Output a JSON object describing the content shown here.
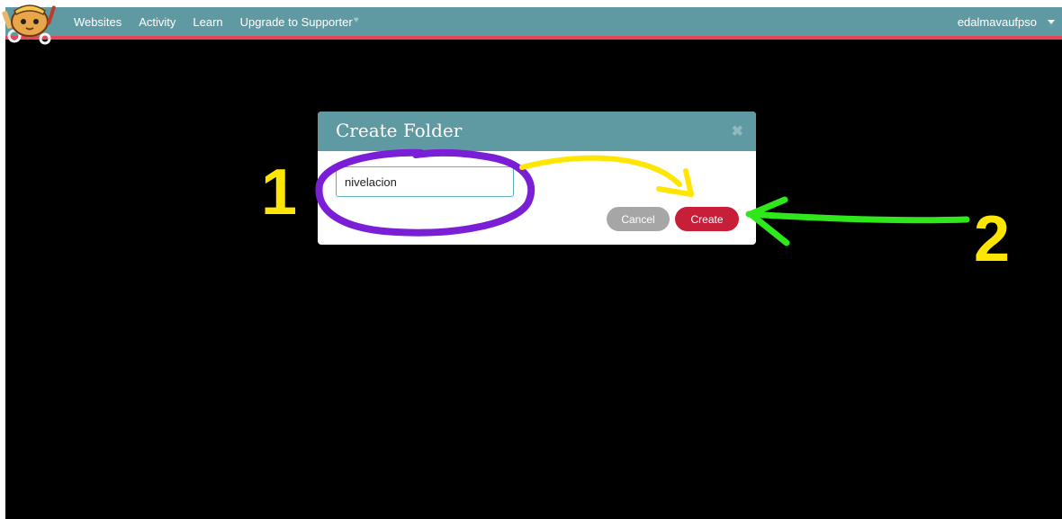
{
  "nav": {
    "links": [
      "Websites",
      "Activity",
      "Learn",
      "Upgrade to Supporter"
    ],
    "username": "edalmavaufpso"
  },
  "modal": {
    "title": "Create Folder",
    "input_value": "nivelacion",
    "cancel_label": "Cancel",
    "create_label": "Create"
  },
  "annotations": {
    "step1_label": "1",
    "step2_label": "2",
    "colors": {
      "circle": "#7a1fd6",
      "arrow_yellow": "#ffe600",
      "arrow_green": "#2ee81c",
      "numbers": "#ffe600"
    }
  },
  "colors": {
    "nav_bg": "#5f9aa3",
    "nav_border": "#e6455a",
    "create_button": "#c71e3a",
    "cancel_button": "#a6a6a6"
  },
  "icons": {
    "logo": "cat-mascot-logo",
    "heart": "heart-icon",
    "close": "close-icon",
    "caret": "caret-down-icon"
  }
}
